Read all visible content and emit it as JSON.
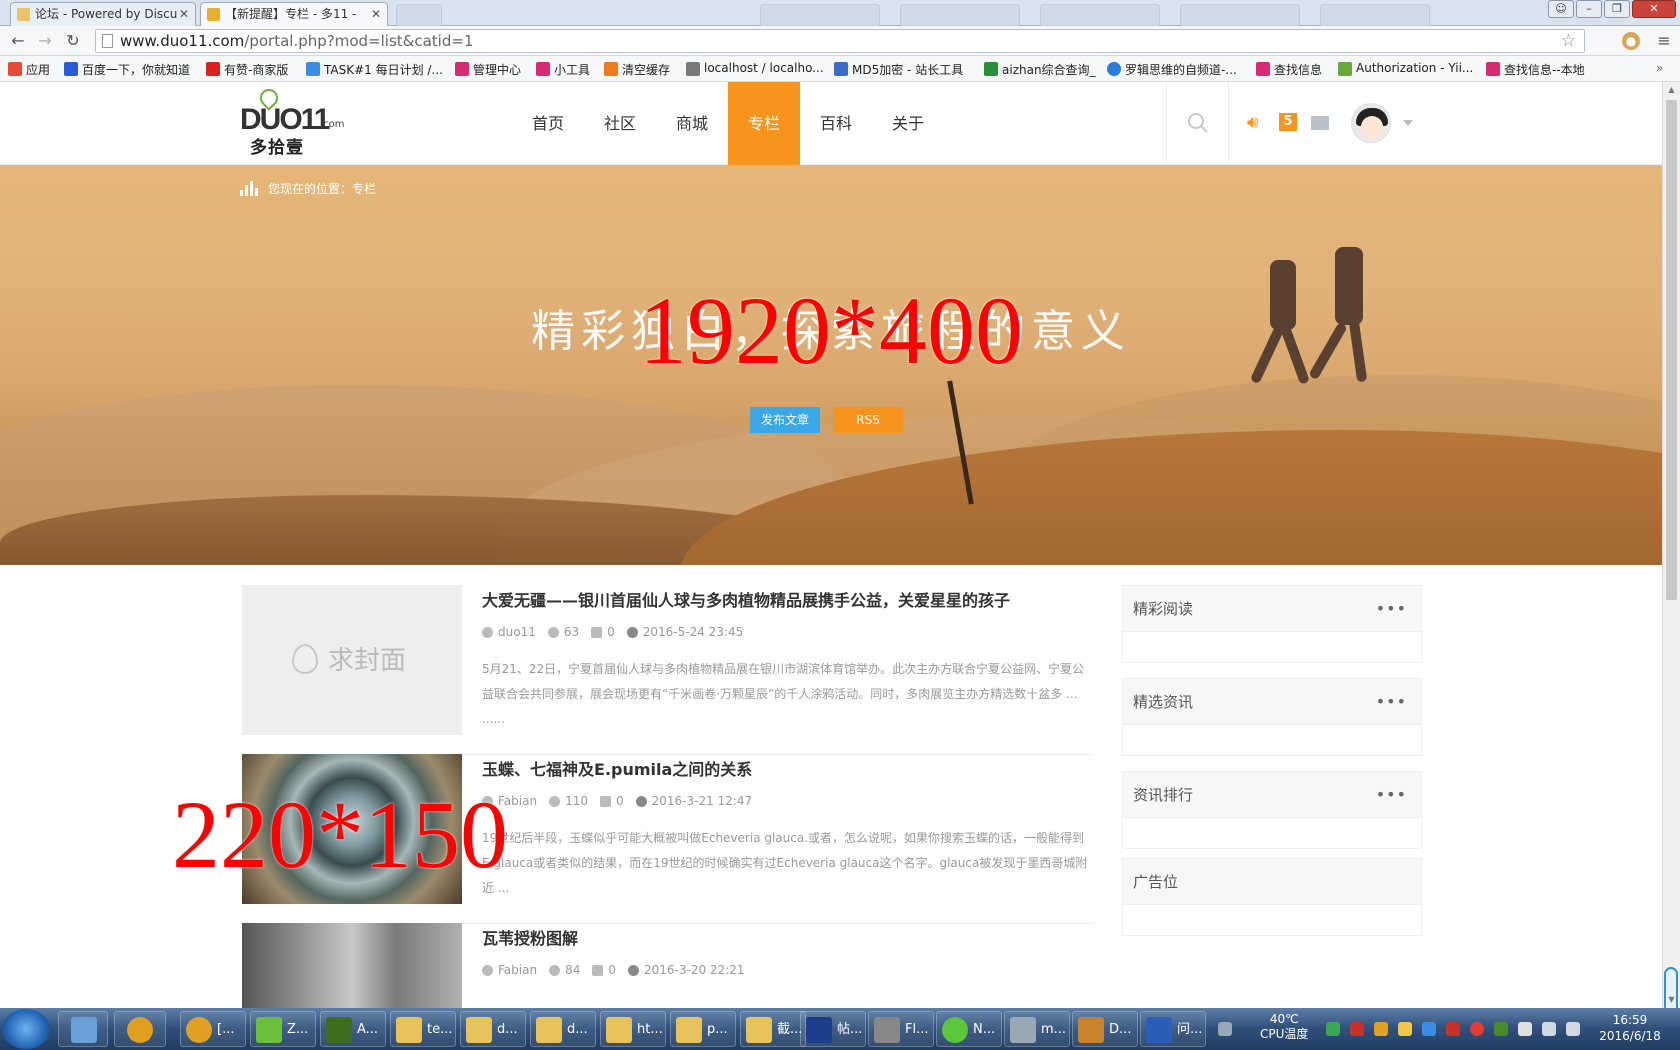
{
  "browser": {
    "tabs": [
      {
        "title": "论坛 - Powered by Discu"
      },
      {
        "title": "【新提醒】专栏 - 多11 - "
      }
    ],
    "url": {
      "host": "www.duo11.com",
      "path": "/portal.php?mod=list&catid=1"
    },
    "bookmarks": [
      {
        "label": "应用",
        "color": "#e84a3a"
      },
      {
        "label": "百度一下，你就知道",
        "color": "#2a5bd7"
      },
      {
        "label": "有赞-商家版",
        "color": "#e02020"
      },
      {
        "label": "TASK#1 每日计划 /...",
        "color": "#3a8ee6"
      },
      {
        "label": "管理中心",
        "color": "#d82c72"
      },
      {
        "label": "小工具",
        "color": "#d82c72"
      },
      {
        "label": "清空缓存",
        "color": "#f07a1e"
      },
      {
        "label": "localhost / localho...",
        "color": "#7a7a7a"
      },
      {
        "label": "MD5加密 - 站长工具",
        "color": "#3a6ec6"
      },
      {
        "label": "aizhan综合查询_",
        "color": "#2b8f3a"
      },
      {
        "label": "罗辑思维的自频道-...",
        "color": "#2a7be0"
      },
      {
        "label": "查找信息",
        "color": "#d82c72"
      },
      {
        "label": "Authorization - Yii...",
        "color": "#6aa83a"
      },
      {
        "label": "查找信息--本地",
        "color": "#d82c72"
      }
    ]
  },
  "site": {
    "logo": {
      "word": "DUO11",
      "com": ".com",
      "cn": "多拾壹"
    },
    "nav": [
      {
        "label": "首页"
      },
      {
        "label": "社区"
      },
      {
        "label": "商城"
      },
      {
        "label": "专栏",
        "active": true
      },
      {
        "label": "百科"
      },
      {
        "label": "关于"
      }
    ],
    "notice_count": "5",
    "accent_color": "#f7941d"
  },
  "banner": {
    "breadcrumb": "您现在的位置：专栏",
    "slogan": "精彩独白，探索旅程的意义",
    "size_label": "1920*400",
    "post_button": "发布文章",
    "rss_button": "RSS"
  },
  "articles": [
    {
      "title": "大爱无疆——银川首届仙人球与多肉植物精品展携手公益，关爱星星的孩子",
      "author": "duo11",
      "views": "63",
      "comments": "0",
      "date": "2016-5-24 23:45",
      "excerpt": "5月21、22日，宁夏首届仙人球与多肉植物精品展在银川市湖滨体育馆举办。此次主办方联合宁夏公益网、宁夏公益联合会共同参展，展会现场更有“千米画卷·万颗星辰”的千人涂鸦活动。同时，多肉展览主办方精选数十盆多 ...",
      "more": "......",
      "cover": "empty",
      "placeholder": "求封面"
    },
    {
      "title": "玉蝶、七福神及E.pumila之间的关系",
      "author": "Fabian",
      "views": "110",
      "comments": "0",
      "date": "2016-3-21 12:47",
      "excerpt": "19世纪后半段，玉蝶似乎可能大概被叫做Echeveria glauca.或者，怎么说呢，如果你搜索玉蝶的话，一般能得到E.glauca或者类似的结果，而在19世纪的时候确实有过Echeveria glauca这个名字。glauca被发现于墨西哥城附近 ...",
      "more": "......",
      "cover": "succ",
      "size_label": "220*150"
    },
    {
      "title": "瓦苇授粉图解",
      "author": "Fabian",
      "views": "84",
      "comments": "0",
      "date": "2016-3-20 22:21",
      "excerpt": "",
      "more": "",
      "cover": "rock"
    }
  ],
  "sidebar": [
    {
      "title": "精彩阅读",
      "dots": "•••"
    },
    {
      "title": "精选资讯",
      "dots": "•••"
    },
    {
      "title": "资讯排行",
      "dots": "•••"
    },
    {
      "title": "广告位",
      "dots": ""
    }
  ],
  "taskbar": {
    "items": [
      {
        "label": "",
        "color": "#6aa0d8"
      },
      {
        "label": "",
        "color": "#e0a020"
      },
      {
        "label": "[...",
        "color": "#e0a020"
      },
      {
        "label": "Z...",
        "color": "#6cbf3c"
      },
      {
        "label": "A...",
        "color": "#3c6e1e"
      },
      {
        "label": "te...",
        "color": "#e7c15a"
      },
      {
        "label": "d...",
        "color": "#e7c15a"
      },
      {
        "label": "d...",
        "color": "#e7c15a"
      },
      {
        "label": "ht...",
        "color": "#e7c15a"
      },
      {
        "label": "p...",
        "color": "#e7c15a"
      },
      {
        "label": "截...",
        "color": "#e7c15a"
      },
      {
        "label": "帖...",
        "color": "#1b3d8a"
      },
      {
        "label": "Fl...",
        "color": "#888888"
      },
      {
        "label": "N...",
        "color": "#5ac83a"
      },
      {
        "label": "m...",
        "color": "#9aa7b5"
      },
      {
        "label": "D...",
        "color": "#c8822a"
      },
      {
        "label": "问...",
        "color": "#2b5eb8"
      }
    ],
    "cpu_temp": "40℃",
    "cpu_label": "CPU温度",
    "time": "16:59",
    "date": "2016/6/18"
  }
}
